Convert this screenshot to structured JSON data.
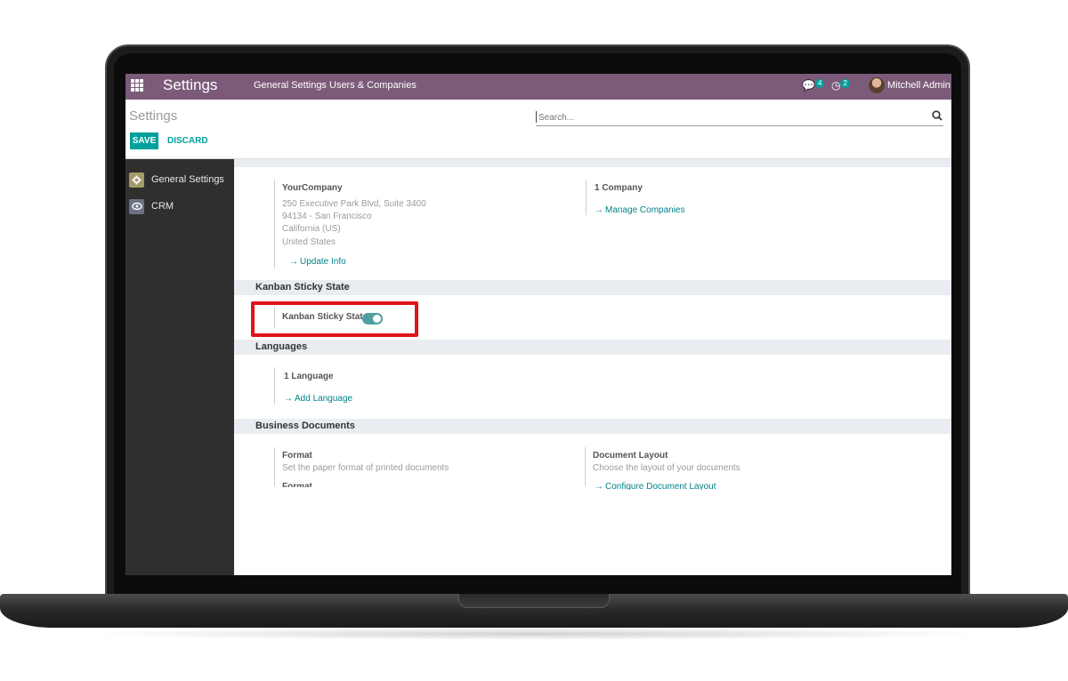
{
  "navbar": {
    "app_title": "Settings",
    "menu": [
      "General Settings",
      "Users & Companies"
    ],
    "messages_count": "4",
    "activities_count": "2",
    "user_name": "Mitchell Admin"
  },
  "control_panel": {
    "breadcrumb": "Settings",
    "search_placeholder": "Search...",
    "save_label": "SAVE",
    "discard_label": "DISCARD"
  },
  "sidebar": {
    "items": [
      {
        "label": "General Settings",
        "icon": "gear-icon"
      },
      {
        "label": "CRM",
        "icon": "crm-icon"
      }
    ]
  },
  "companies": {
    "company_name": "YourCompany",
    "address_lines": [
      "250 Executive Park Blvd, Suite 3400",
      "94134 - San Francisco",
      "California (US)",
      "United States"
    ],
    "update_info": "Update Info",
    "company_count": "1 Company",
    "manage_companies": "Manage Companies"
  },
  "kanban": {
    "section_title": "Kanban Sticky State",
    "field_label": "Kanban Sticky State",
    "enabled": true
  },
  "languages": {
    "section_title": "Languages",
    "count": "1 Language",
    "add_language": "Add Language"
  },
  "business_documents": {
    "section_title": "Business Documents",
    "format_title": "Format",
    "format_desc": "Set the paper format of printed documents",
    "format_partial": "Format",
    "layout_title": "Document Layout",
    "layout_desc": "Choose the layout of your documents",
    "configure_layout": "Configure Document Layout"
  },
  "colors": {
    "navbar": "#7c5b7a",
    "accent": "#00a09d",
    "highlight": "#e0141a"
  }
}
